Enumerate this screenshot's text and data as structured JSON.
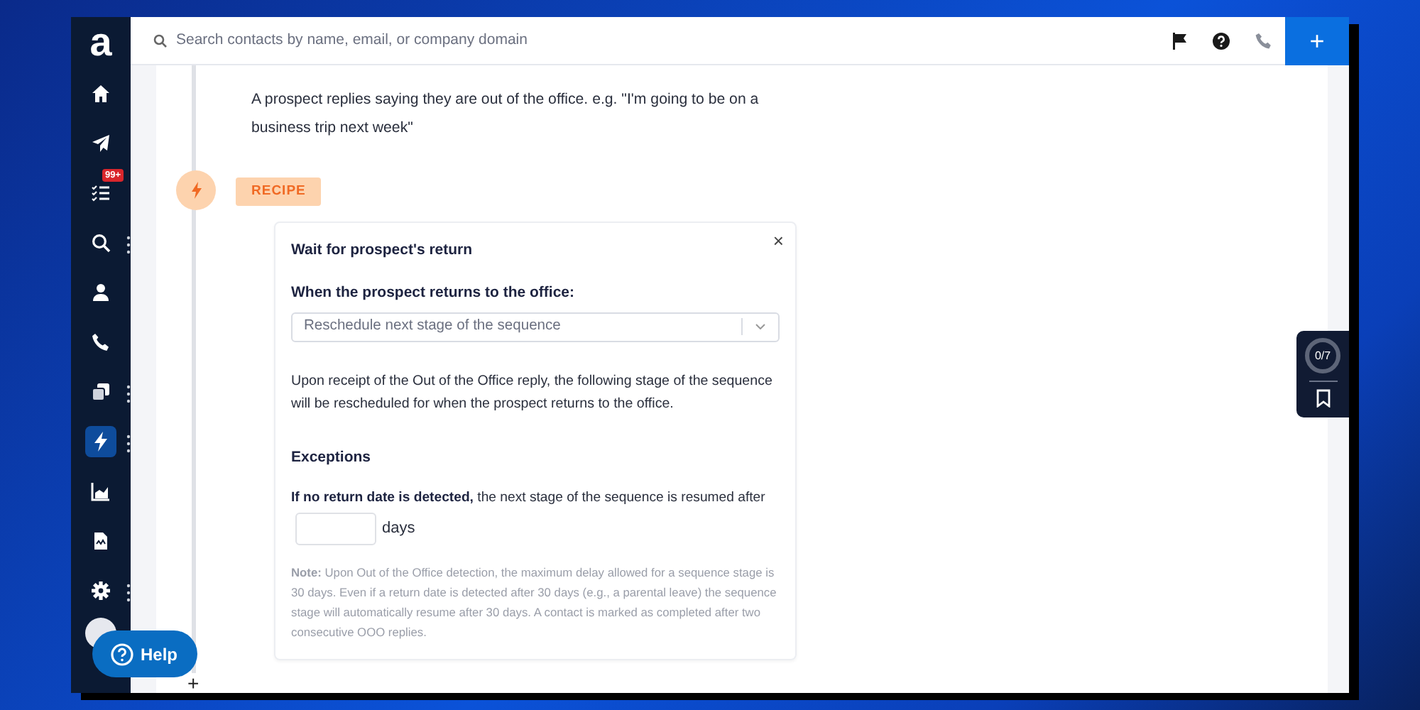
{
  "sidebar": {
    "logo": "a",
    "items": [
      {
        "selected": false,
        "has_menu": false
      },
      {
        "selected": false,
        "has_menu": false
      },
      {
        "selected": false,
        "has_menu": false,
        "badge": "99+"
      },
      {
        "selected": false,
        "has_menu": true
      },
      {
        "selected": false,
        "has_menu": false
      },
      {
        "selected": false,
        "has_menu": false
      },
      {
        "selected": false,
        "has_menu": true
      },
      {
        "selected": true,
        "has_menu": true
      },
      {
        "selected": false,
        "has_menu": false
      },
      {
        "selected": false,
        "has_menu": false
      },
      {
        "selected": false,
        "has_menu": true
      }
    ]
  },
  "top_bar": {
    "search": {
      "placeholder": "Search contacts by name, email, or company domain"
    },
    "add_button": "+"
  },
  "step": {
    "description": "A prospect replies saying they are out of the office. e.g. \"I'm going to be on a business trip next week\"",
    "badge": "RECIPE",
    "card": {
      "title": "Wait for prospect's return",
      "close": "×",
      "select_label": "When the prospect returns to the office:",
      "select_value": "Reschedule next stage of the sequence",
      "info": "Upon receipt of the Out of the Office reply, the following stage of the sequence will be rescheduled for when the prospect returns to the office.",
      "exceptions_heading": "Exceptions",
      "exception_text": "**If no return date is detected,** the next stage of the sequence is resumed after",
      "days_unit": "days",
      "note": "**Note:** Upon Out of the Office detection, the maximum delay allowed for a sequence stage is 30 days. Even if a return date is detected after 30 days (e.g., a parental leave) the sequence stage will automatically resume after 30 days. A contact is marked as completed after two consecutive OOO replies."
    },
    "add": "+"
  },
  "help_button": "Help",
  "progress_widget": {
    "text": "0/7"
  }
}
